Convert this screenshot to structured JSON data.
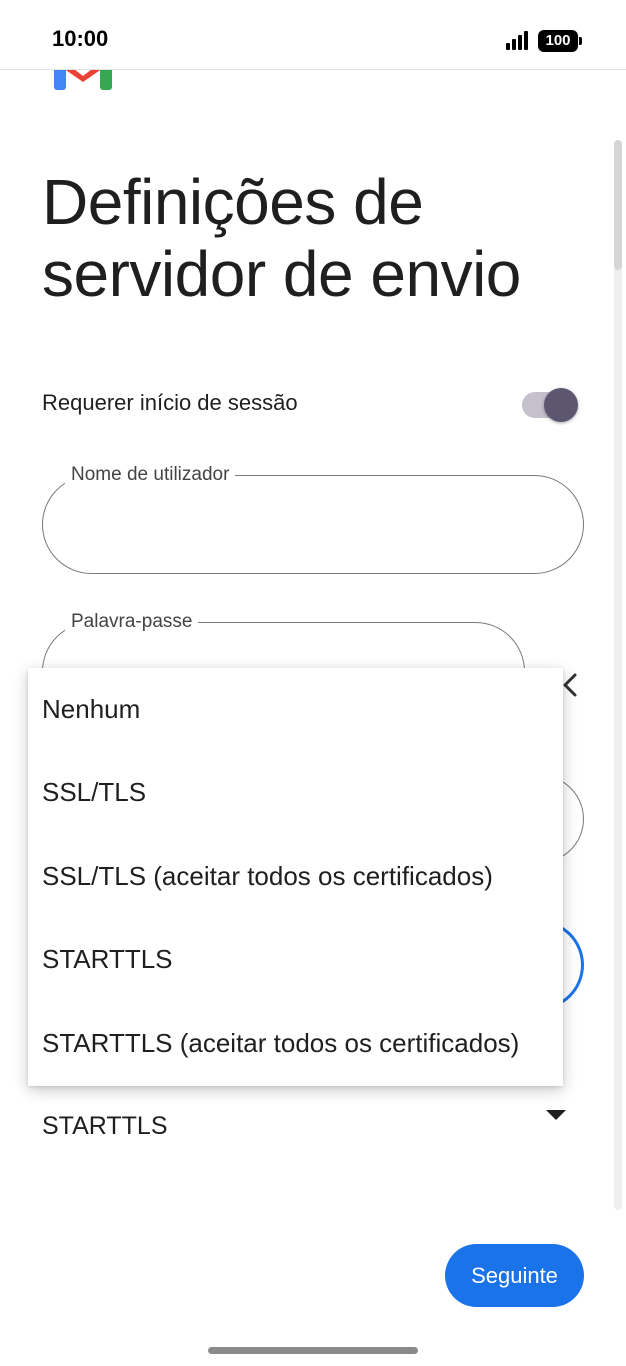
{
  "status_bar": {
    "time": "10:00",
    "battery": "100"
  },
  "page": {
    "title": "Definições de servidor de envio"
  },
  "login_toggle": {
    "label": "Requerer início de sessão",
    "enabled": true
  },
  "username_field": {
    "label": "Nome de utilizador",
    "value": ""
  },
  "password_field": {
    "label": "Palavra-passe",
    "value": ""
  },
  "security_type": {
    "selected": "STARTTLS",
    "options": [
      "Nenhum",
      "SSL/TLS",
      "SSL/TLS (aceitar todos os certificados)",
      "STARTTLS",
      "STARTTLS (aceitar todos os certificados)"
    ]
  },
  "actions": {
    "next_label": "Seguinte"
  },
  "colors": {
    "primary": "#1a73e8",
    "toggle_knob": "#5d5671",
    "toggle_track": "#c4c1cc"
  },
  "icons": {
    "logo": "gmail-logo",
    "password_visibility": "eye-icon",
    "dropdown": "triangle-down-icon",
    "collapse": "chevron-left-icon"
  }
}
